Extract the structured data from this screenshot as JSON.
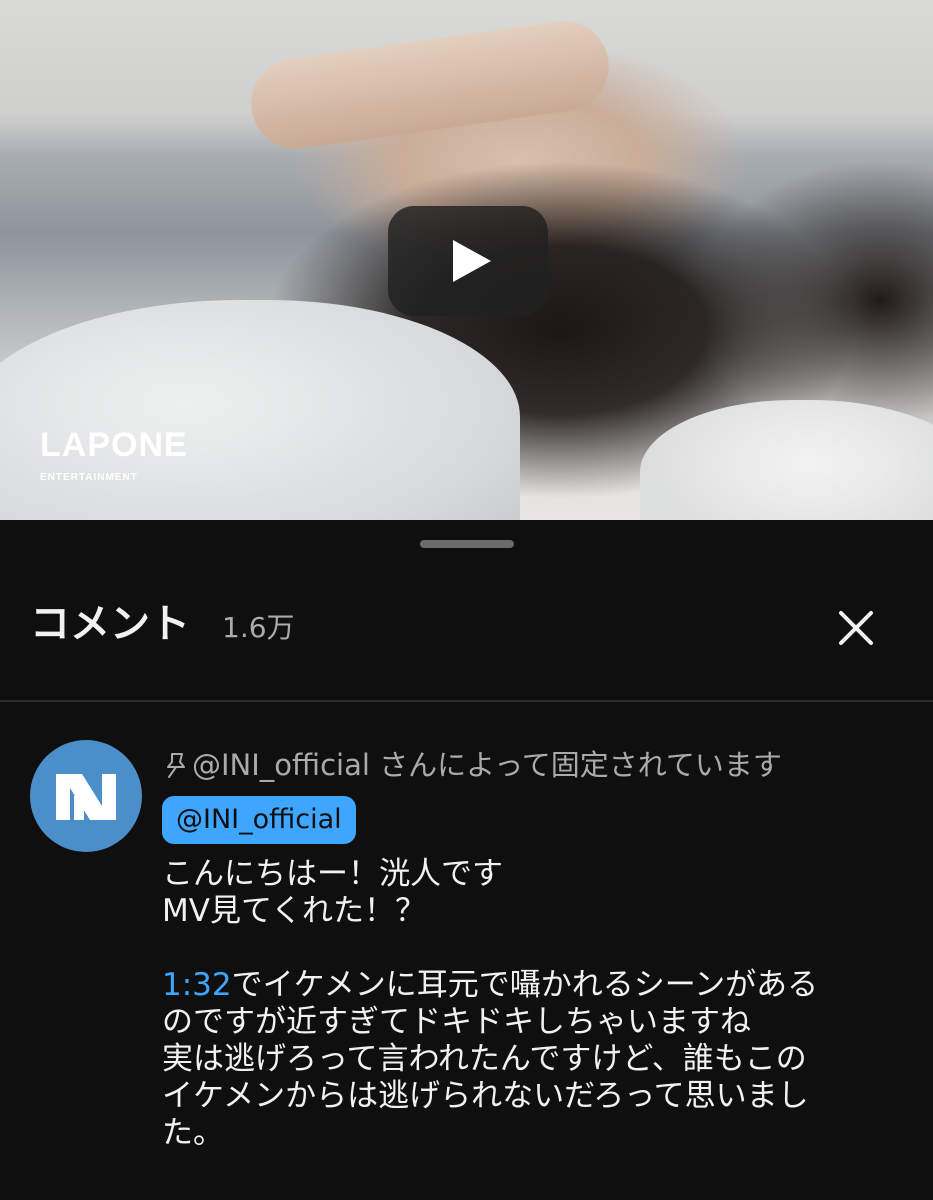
{
  "video": {
    "logo_text": "LAPONE",
    "logo_subtext": "ENTERTAINMENT",
    "play_icon": "play-icon"
  },
  "comments_panel": {
    "title": "コメント",
    "count": "1.6万",
    "close_icon": "close-icon"
  },
  "pinned_comment": {
    "pinned_label": "@INI_official さんによって固定されています",
    "pin_icon": "pin-icon",
    "author": "@INI_official",
    "avatar_color": "#4a8fc9",
    "lines": {
      "l1": "こんにちはー！洸人です",
      "l2": "MV見てくれた！？",
      "l3_timestamp": "1:32",
      "l3_rest": "でイケメンに耳元で囁かれるシーンがある",
      "l4": "のですが近すぎてドキドキしちゃいますね",
      "l5": "実は逃げろって言われたんですけど、誰もこの",
      "l6": "イケメンからは逃げられないだろって思いまし",
      "l7": "た。"
    }
  },
  "colors": {
    "background": "#0f0f0f",
    "accent_blue": "#3ea6ff",
    "secondary_text": "#aaaaaa"
  }
}
